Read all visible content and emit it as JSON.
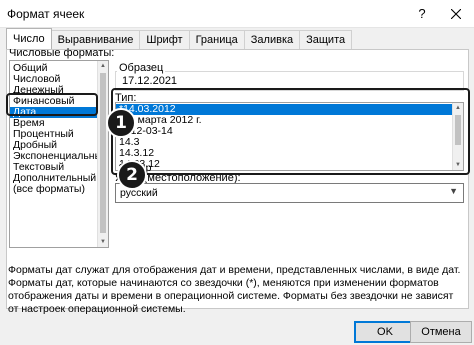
{
  "window": {
    "title": "Формат ячеек",
    "help": "?",
    "close_icon": "close-icon"
  },
  "tabs": [
    "Число",
    "Выравнивание",
    "Шрифт",
    "Граница",
    "Заливка",
    "Защита"
  ],
  "categories": {
    "label": "Числовые форматы:",
    "items": [
      "Общий",
      "Числовой",
      "Денежный",
      "Финансовый",
      "Дата",
      "Время",
      "Процентный",
      "Дробный",
      "Экспоненциальный",
      "Текстовый",
      "Дополнительный",
      "(все форматы)"
    ],
    "selected": "Дата"
  },
  "sample": {
    "label": "Образец",
    "value": "17.12.2021"
  },
  "type": {
    "label": "Тип:",
    "items": [
      "*14.03.2012",
      "*14 марта 2012 г.",
      "2012-03-14",
      "14.3",
      "14.3.12",
      "14.03.12",
      "14 мар"
    ],
    "selected": "*14.03.2012"
  },
  "locale": {
    "label": "Язык (местоположение):",
    "value": "русский"
  },
  "description": "Форматы дат служат для отображения дат и времени, представленных числами, в виде дат. Форматы дат, которые начинаются со звездочки (*), меняются при изменении форматов отображения даты и времени в операционной системе. Форматы без звездочки не зависят от настроек операционной системы.",
  "buttons": {
    "ok": "OK",
    "cancel": "Отмена"
  },
  "annotations": [
    "1",
    "2"
  ],
  "colors": {
    "selection": "#0078d7",
    "annotation": "#1a1a1a"
  }
}
